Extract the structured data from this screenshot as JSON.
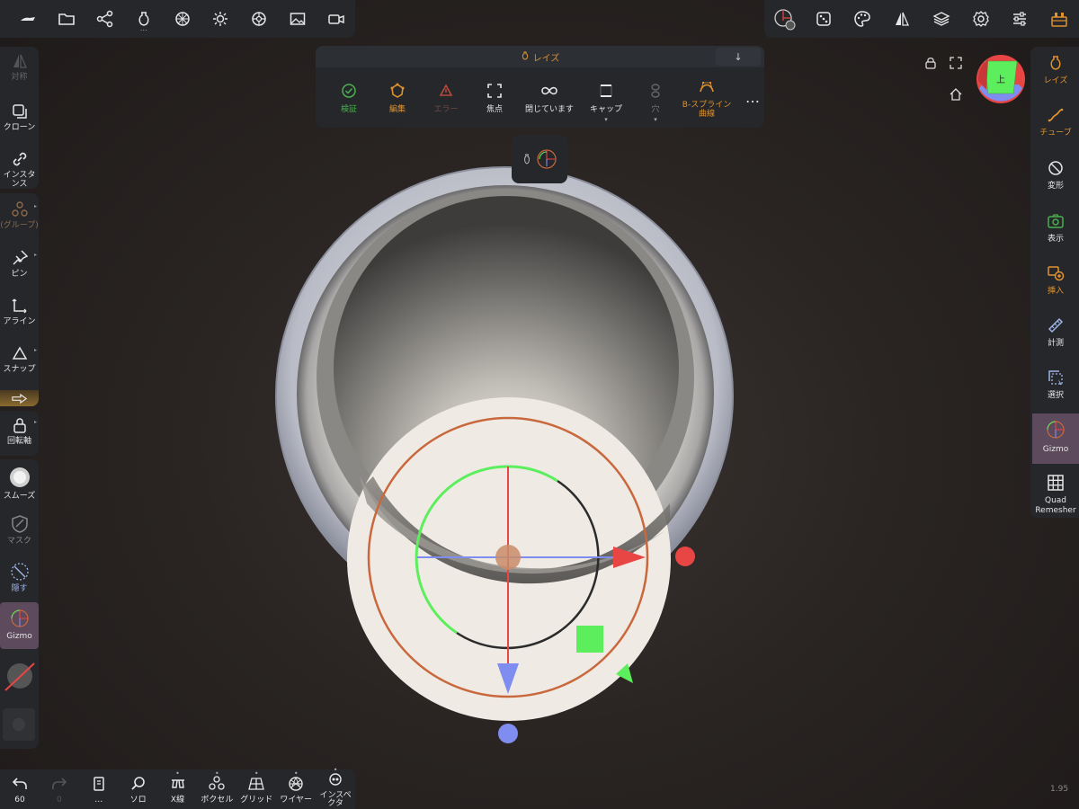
{
  "top_left_toolbar": {
    "items": [
      {
        "icon": "nomad-logo-icon"
      },
      {
        "icon": "folder-icon"
      },
      {
        "icon": "scene-graph-icon"
      },
      {
        "icon": "vase-icon",
        "dots": "…"
      },
      {
        "icon": "sphere-icon"
      },
      {
        "icon": "light-icon"
      },
      {
        "icon": "postprocess-icon"
      },
      {
        "icon": "image-icon"
      },
      {
        "icon": "camera-icon"
      }
    ]
  },
  "top_right_toolbar": {
    "items": [
      {
        "icon": "gizmo-settings-icon"
      },
      {
        "icon": "dice-icon",
        "dots": "…"
      },
      {
        "icon": "palette-icon"
      },
      {
        "icon": "symmetry-icon"
      },
      {
        "icon": "layers-icon"
      },
      {
        "icon": "settings-gear-icon"
      },
      {
        "icon": "sliders-icon"
      },
      {
        "icon": "toolbox-icon"
      }
    ]
  },
  "tool_panel": {
    "header": "レイズ",
    "header_icon": "vase-icon",
    "download_label": "↓",
    "tools": [
      {
        "label": "検証",
        "color": "#4caf50",
        "icon": "check-circle-icon"
      },
      {
        "label": "編集",
        "color": "#e0922f",
        "icon": "edit-shape-icon"
      },
      {
        "label": "エラー",
        "color": "#b74a3a",
        "icon": "error-triangle-icon",
        "disabled": true
      },
      {
        "label": "焦点",
        "color": "#e6e6e6",
        "icon": "focus-icon"
      },
      {
        "label": "閉じています",
        "color": "#e6e6e6",
        "icon": "infinity-icon"
      },
      {
        "label": "キャップ",
        "color": "#e6e6e6",
        "icon": "cap-icon",
        "dots": "▾"
      },
      {
        "label": "穴",
        "color": "#777777",
        "icon": "hole-icon",
        "disabled": true,
        "dots": "▾"
      },
      {
        "label": "B-スプライン曲線",
        "color": "#e0922f",
        "icon": "bspline-icon"
      },
      {
        "label": "…",
        "color": "#e6e6e6",
        "icon": "more-icon"
      }
    ]
  },
  "left_toolbar": {
    "items": [
      {
        "label": "対称",
        "icon": "symmetry-icon",
        "disabled": true
      },
      {
        "label": "クローン",
        "icon": "clone-icon"
      },
      {
        "label": "インスタンス",
        "icon": "link-icon"
      },
      {
        "label": "(グループ)",
        "icon": "group-icon",
        "disabled": true
      },
      {
        "label": "ピン",
        "icon": "pin-icon"
      },
      {
        "label": "アライン",
        "icon": "align-icon"
      },
      {
        "label": "スナップ",
        "icon": "snap-icon"
      },
      {
        "label": "回転軸",
        "icon": "lock-icon"
      },
      {
        "label": "スムーズ",
        "icon": "smooth-icon"
      },
      {
        "label": "マスク",
        "icon": "mask-icon",
        "disabled": true
      },
      {
        "label": "隠す",
        "icon": "hide-icon"
      },
      {
        "label": "Gizmo",
        "icon": "gizmo-icon",
        "active": true
      }
    ]
  },
  "right_toolbar": {
    "items": [
      {
        "label": "レイズ",
        "icon": "vase-icon",
        "color": "#e0922f"
      },
      {
        "label": "チューブ",
        "icon": "tube-icon",
        "color": "#e0922f"
      },
      {
        "label": "変形",
        "icon": "transform-icon",
        "color": "#e6e6e6"
      },
      {
        "label": "表示",
        "icon": "camera-view-icon",
        "color": "#e6e6e6"
      },
      {
        "label": "挿入",
        "icon": "insert-icon",
        "color": "#e0922f"
      },
      {
        "label": "計測",
        "icon": "ruler-icon",
        "color": "#e6e6e6"
      },
      {
        "label": "選択",
        "icon": "select-icon",
        "color": "#e6e6e6"
      },
      {
        "label": "Gizmo",
        "icon": "gizmo-icon",
        "color": "#e6e6e6",
        "active": true
      },
      {
        "label": "Quad Remesher",
        "icon": "grid-icon",
        "color": "#e6e6e6"
      }
    ]
  },
  "bottom_toolbar": {
    "items": [
      {
        "label": "60",
        "icon": "undo-icon"
      },
      {
        "label": "0",
        "icon": "redo-icon",
        "disabled": true
      },
      {
        "label": "…",
        "icon": "book-icon"
      },
      {
        "label": "ソロ",
        "icon": "search-icon"
      },
      {
        "label": "X線",
        "icon": "xray-icon",
        "dots": "•"
      },
      {
        "label": "ボクセル",
        "icon": "voxel-icon",
        "dots": "•"
      },
      {
        "label": "グリッド",
        "icon": "grid-floor-icon",
        "dots": "•"
      },
      {
        "label": "ワイヤー",
        "icon": "wireframe-icon",
        "dots": "•"
      },
      {
        "label": "インスペクタ",
        "icon": "inspector-icon",
        "dots": "•"
      }
    ]
  },
  "view_cube": {
    "label": "上"
  },
  "version": "1.95",
  "colors": {
    "accent": "#e0922f",
    "panel": "#25272b",
    "active": "#5d4a5c",
    "gizmo_red": "#e84545",
    "gizmo_green": "#5dee5d",
    "gizmo_blue": "#7f8cf0",
    "ring_orange": "#c9683d"
  }
}
